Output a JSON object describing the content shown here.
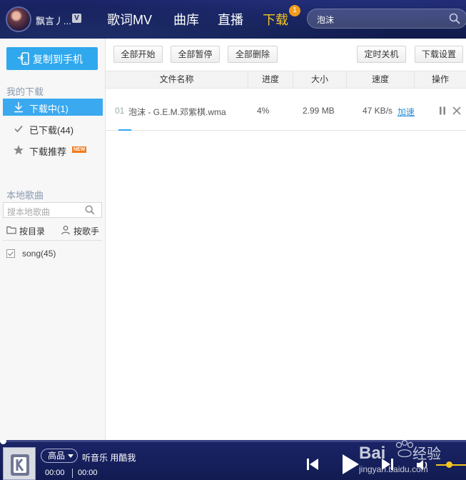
{
  "header": {
    "username": "飘言丿...",
    "vip_label": "V",
    "nav": [
      {
        "label": "歌词MV"
      },
      {
        "label": "曲库"
      },
      {
        "label": "直播"
      },
      {
        "label": "下载",
        "badge": "1",
        "active": true
      }
    ],
    "search_value": "泡沫",
    "accent_color": "#f7c61f"
  },
  "sidebar": {
    "copy_button": "复制到手机",
    "my_downloads_title": "我的下载",
    "items": [
      {
        "label": "下载中(1)",
        "icon": "download-arrow-icon",
        "active": true
      },
      {
        "label": "已下载(44)",
        "icon": "check-icon"
      },
      {
        "label": "下载推荐",
        "icon": "star-icon",
        "tag": "NEW"
      }
    ],
    "local_title": "本地歌曲",
    "local_search_placeholder": "搜本地歌曲",
    "filters": [
      {
        "label": "按目录",
        "icon": "folder-icon"
      },
      {
        "label": "按歌手",
        "icon": "user-icon"
      }
    ],
    "song_folder": "song(45)"
  },
  "toolbar": {
    "start_all": "全部开始",
    "pause_all": "全部暂停",
    "delete_all": "全部删除",
    "timer_shutdown": "定时关机",
    "download_settings": "下载设置"
  },
  "table": {
    "columns": [
      "文件名称",
      "进度",
      "大小",
      "速度",
      "操作"
    ],
    "rows": [
      {
        "index": "01",
        "name": "泡沫 - G.E.M.邓紫棋.wma",
        "progress": "4%",
        "size": "2.99 MB",
        "speed": "47 KB/s",
        "speedup": "加速"
      }
    ]
  },
  "player": {
    "quality": "高品",
    "now_playing": "听音乐 用酷我",
    "elapsed": "00:00",
    "total": "00:00"
  },
  "watermark": {
    "brand": "Bai",
    "brand_cn": "经验",
    "site": "jingyan.baidu.com"
  }
}
